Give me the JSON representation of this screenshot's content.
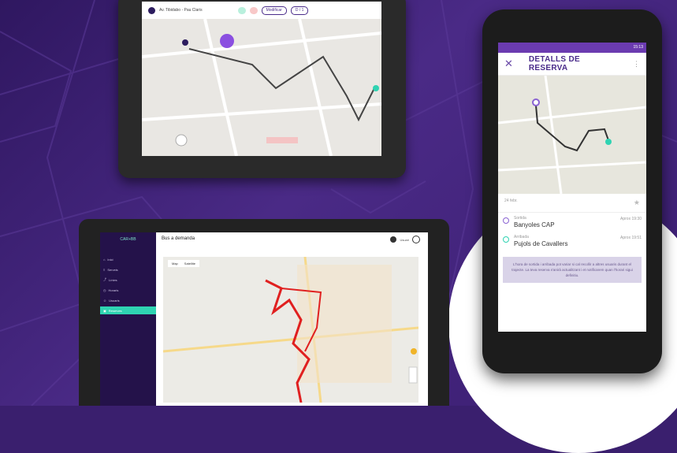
{
  "tablet": {
    "route_label": "Av. Tibidabo - Pau Claris",
    "chip_a": "",
    "chip_b": "",
    "btn_a": "Modificar",
    "btn_b": "D / 1",
    "map_badge": ""
  },
  "laptop": {
    "brand": "CAR+BB",
    "page_title": "Bus a demanda",
    "user": "Usuari",
    "map_tabs": [
      "Map",
      "Satellite"
    ],
    "sidebar_items": [
      "Inici",
      "Serveis",
      "Línies",
      "Horaris",
      "Reserves",
      "Usuaris"
    ],
    "active_item": "Reserves"
  },
  "phone": {
    "status_time": "15:13",
    "title": "DETALLS DE RESERVA",
    "date_row": "24 febr.",
    "departure_label": "Sortida",
    "departure_name": "Banyoles CAP",
    "departure_time": "Aprox 19:30",
    "arrival_label": "Arribada",
    "arrival_name": "Pujols de Cavallers",
    "arrival_time": "Aprox 19:51",
    "note": "L'hora de sortida i arribada pot variar si cal recollir a altres usuaris durant el trajecte. La teva reserva s'anirà actualitzant i et notificarem quan l'horari sigui definitiu."
  }
}
